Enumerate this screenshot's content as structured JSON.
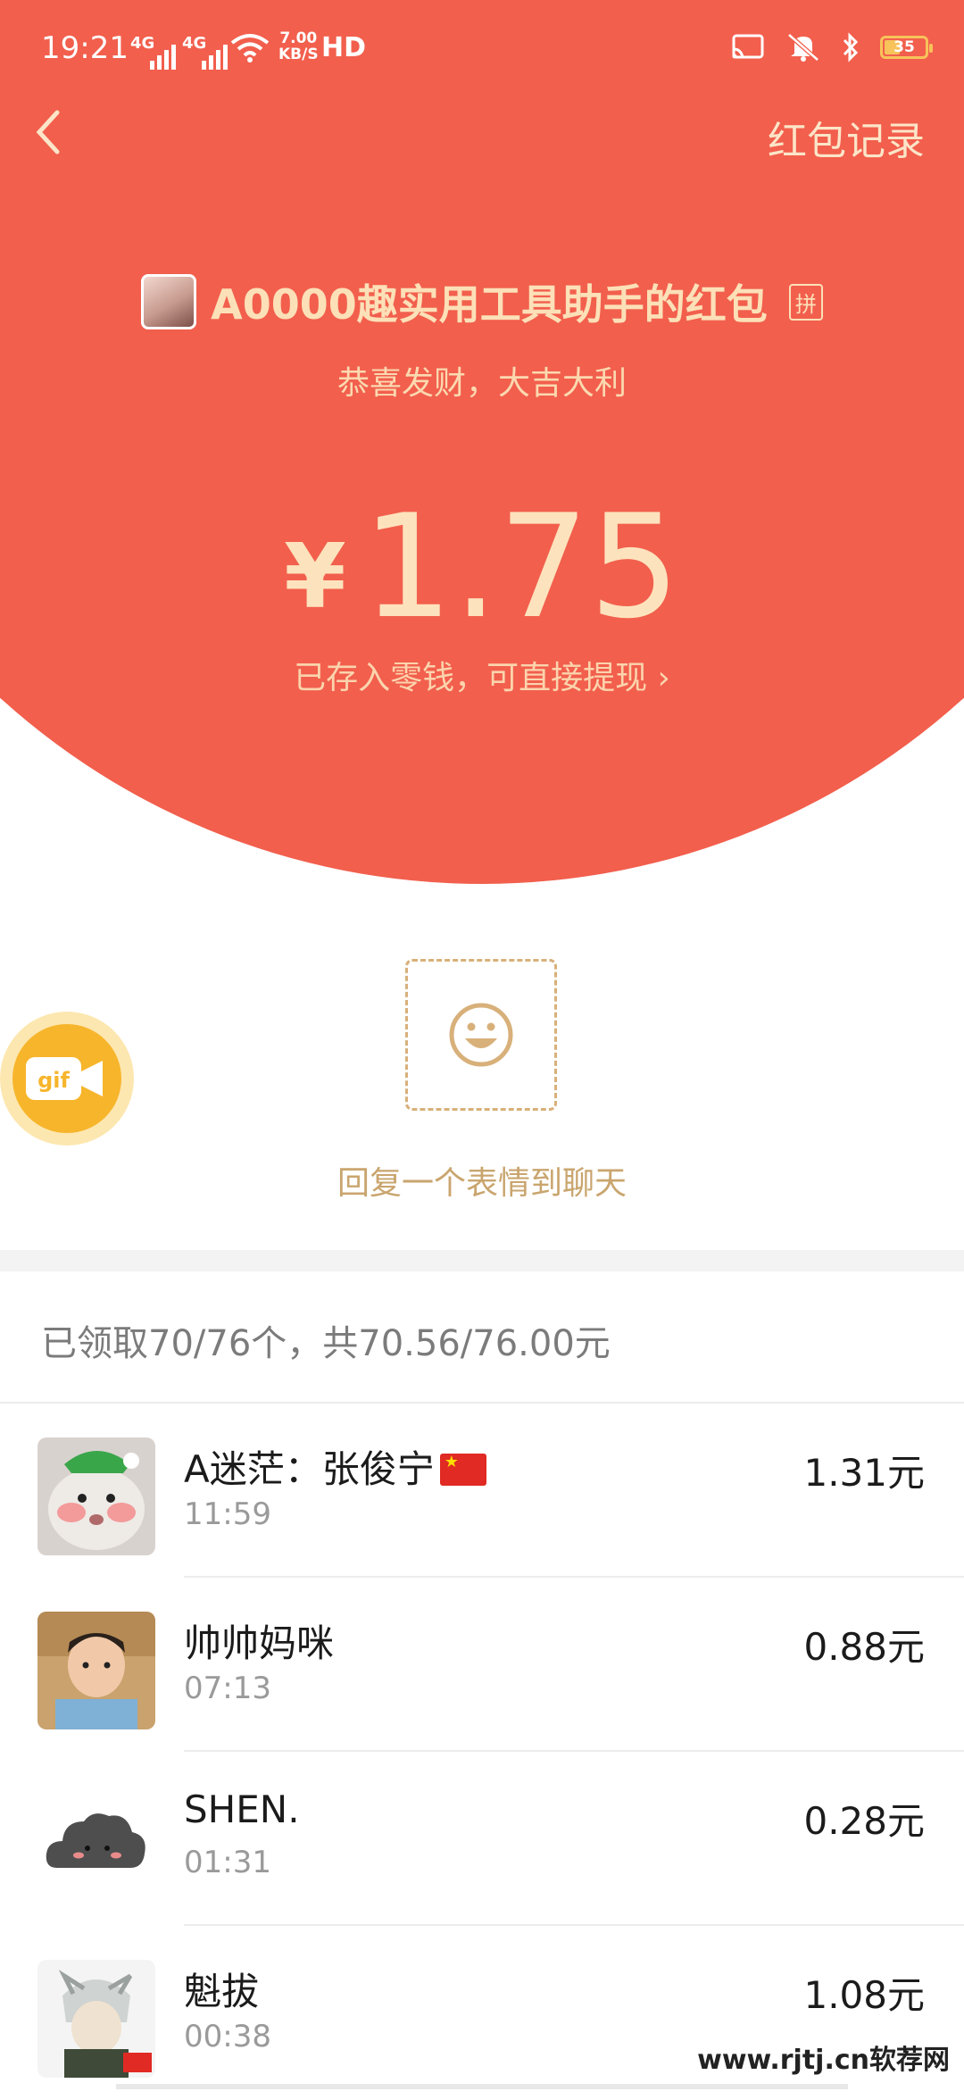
{
  "status_bar": {
    "time": "19:21",
    "network_1": "4G",
    "network_2": "4G",
    "speed_value": "7.00",
    "speed_unit": "KB/S",
    "hd": "HD",
    "battery": "35"
  },
  "header": {
    "back_icon": "chevron-left-icon",
    "records_label": "红包记录"
  },
  "envelope": {
    "sender_name": "A0000趣实用工具助手的红包",
    "badge": "拼",
    "blessing": "恭喜发财，大吉大利",
    "currency": "¥",
    "amount": "1.75",
    "stored_note": "已存入零钱，可直接提现 ›"
  },
  "reply": {
    "emoji_icon": "smiley-icon",
    "label": "回复一个表情到聊天",
    "gif_icon": "gif-camera-icon",
    "gif_text": "gif"
  },
  "summary": {
    "text": "已领取70/76个，共70.56/76.00元"
  },
  "recipients": [
    {
      "name": "A迷茫：张俊宁",
      "has_flag": true,
      "time": "11:59",
      "amount": "1.31元"
    },
    {
      "name": "帅帅妈咪",
      "has_flag": false,
      "time": "07:13",
      "amount": "0.88元"
    },
    {
      "name": "SHEN.",
      "has_flag": false,
      "time": "01:31",
      "amount": "0.28元"
    },
    {
      "name": "魁拔",
      "has_flag": false,
      "time": "00:38",
      "amount": "1.08元"
    }
  ],
  "watermark": "www.rjtj.cn软荐网",
  "colors": {
    "hero_red": "#f25f4d",
    "gold_text": "#fce0b8",
    "emoji_gold": "#d8b07a",
    "gif_orange": "#f7b52c"
  }
}
